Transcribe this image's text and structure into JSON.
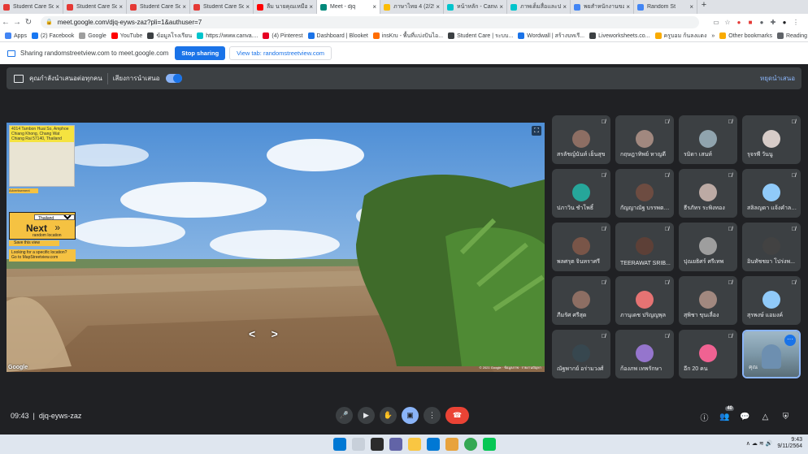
{
  "browser": {
    "tabs": [
      {
        "label": "Student Care Sc",
        "color": "#e53935",
        "active": false
      },
      {
        "label": "Student Care Sc",
        "color": "#e53935",
        "active": false
      },
      {
        "label": "Student Care Sc",
        "color": "#e53935",
        "active": false
      },
      {
        "label": "Student Care Sc",
        "color": "#e53935",
        "active": false
      },
      {
        "label": "ลืม นายคุณเหมือนเป็นฉาก",
        "color": "#ff0000",
        "active": false
      },
      {
        "label": "Meet - djq",
        "color": "#00897b",
        "active": true
      },
      {
        "label": "ภาษาไทย 4 (2/25",
        "color": "#fbbc04",
        "active": false
      },
      {
        "label": "หน้าหลัก - Canva",
        "color": "#00c4cc",
        "active": false
      },
      {
        "label": "ภาพเต็มสื่อและประ",
        "color": "#00c4cc",
        "active": false
      },
      {
        "label": "พยสำหนักงานของ",
        "color": "#4285f4",
        "active": false
      },
      {
        "label": "Random St",
        "color": "#4285f4",
        "active": false
      }
    ],
    "new_tab": "+",
    "url": "meet.google.com/djq-eyws-zaz?pli=1&authuser=7",
    "bookmarks": [
      {
        "label": "Apps",
        "color": "#4285f4"
      },
      {
        "label": "(2) Facebook",
        "color": "#1877f2"
      },
      {
        "label": "Google",
        "color": "#9e9e9e"
      },
      {
        "label": "YouTube",
        "color": "#ff0000"
      },
      {
        "label": "ข้อมูลโรงเรียน",
        "color": "#3c4043"
      },
      {
        "label": "https://www.canva....",
        "color": "#00c4cc"
      },
      {
        "label": "(4) Pinterest",
        "color": "#e60023"
      },
      {
        "label": "Dashboard | Blooket",
        "color": "#1a73e8"
      },
      {
        "label": "insKru - พื้นที่แบ่งปันไอ...",
        "color": "#ff6d00"
      },
      {
        "label": "Student Care | ระบบ...",
        "color": "#3c4043"
      },
      {
        "label": "Wordwall | สร้างบทเรี...",
        "color": "#1a73e8"
      },
      {
        "label": "Liveworksheets.co...",
        "color": "#3c4043"
      },
      {
        "label": "ครูบอม ก้นลงแดง",
        "color": "#f9ab00"
      }
    ],
    "bookmarks_more": "»",
    "other_bookmarks": "Other bookmarks",
    "reading_list": "Reading list"
  },
  "sharing": {
    "text": "Sharing randomstreetview.com to meet.google.com",
    "stop_button": "Stop sharing",
    "view_tab_button": "View tab: randomstreetview.com"
  },
  "presentation_bar": {
    "presenting_label": "คุณกำลังนำเสนอต่อทุกคน",
    "audio_label": "เสียงการนำเสนอ",
    "stop_label": "หยุดนำเสนอ"
  },
  "stage": {
    "map_address": "4014 Tambon Huai So, Amphoe Chiang Khong, Chang Wat Chiang Rai 57140, Thailand",
    "advertisement": "Advertisement",
    "country_select": "Thailand",
    "next_label": "Next",
    "next_sub": "random location",
    "save_label": "Save this view",
    "look_text": "Looking for a specific location? Go to MapStreetview.com",
    "google_logo": "Google",
    "copyright": "© 2021 Google · ข้อมูลภาพ · รายงานปัญหา"
  },
  "participants": [
    {
      "name": "สรลัชญ์นันท์ เย็นสุข",
      "color": "#8d6e63"
    },
    {
      "name": "กฤษฎาทิพย์ หาญดี",
      "color": "#a1887f"
    },
    {
      "name": "รมิดา เสนห์",
      "color": "#90a4ae"
    },
    {
      "name": "รุจรพี วันนู",
      "color": "#d7ccc8"
    },
    {
      "name": "ปภาวิน ชำโพธิ์",
      "color": "#26a69a"
    },
    {
      "name": "กัญญาณัฐ บรรพตวิเศษ",
      "color": "#6d4c41"
    },
    {
      "name": "ธีรภัทร ระพิงทอง",
      "color": "#bcaaa4"
    },
    {
      "name": "สลิลญดา แจ้งคำลาย",
      "color": "#90caf9"
    },
    {
      "name": "พลศรุต จินหราศรี",
      "color": "#795548"
    },
    {
      "name": "TEERAWAT SRIB...",
      "color": "#5d4037"
    },
    {
      "name": "ปุณยธิศร์ ศรีเทพ",
      "color": "#9e9e9e"
    },
    {
      "name": "อินทัชชยา โปร่งพ...",
      "color": "#424242"
    },
    {
      "name": "ภีมรัศ ศรีสุด",
      "color": "#8d6e63"
    },
    {
      "name": "ภานุเดช ปริญญพุล",
      "color": "#e57373"
    },
    {
      "name": "สุพิชา ขุนเลื่อง",
      "color": "#a1887f"
    },
    {
      "name": "สุรพงษ์ แอมงค์",
      "color": "#90caf9"
    },
    {
      "name": "ณัฐพากย์ อร่ามวงศ์",
      "color": "#37474f"
    },
    {
      "name": "ก้องภพ เทพรักษา",
      "color": "#9575cd"
    },
    {
      "name": "อีก 20 คน",
      "color": "#f06292"
    },
    {
      "name": "คุณ",
      "color": "#6d8fb0"
    }
  ],
  "meeting": {
    "time": "09:43",
    "code": "djq-eyws-zaz",
    "participants_count": "40"
  },
  "taskbar": {
    "time": "9:43",
    "date": "9/11/2564"
  }
}
